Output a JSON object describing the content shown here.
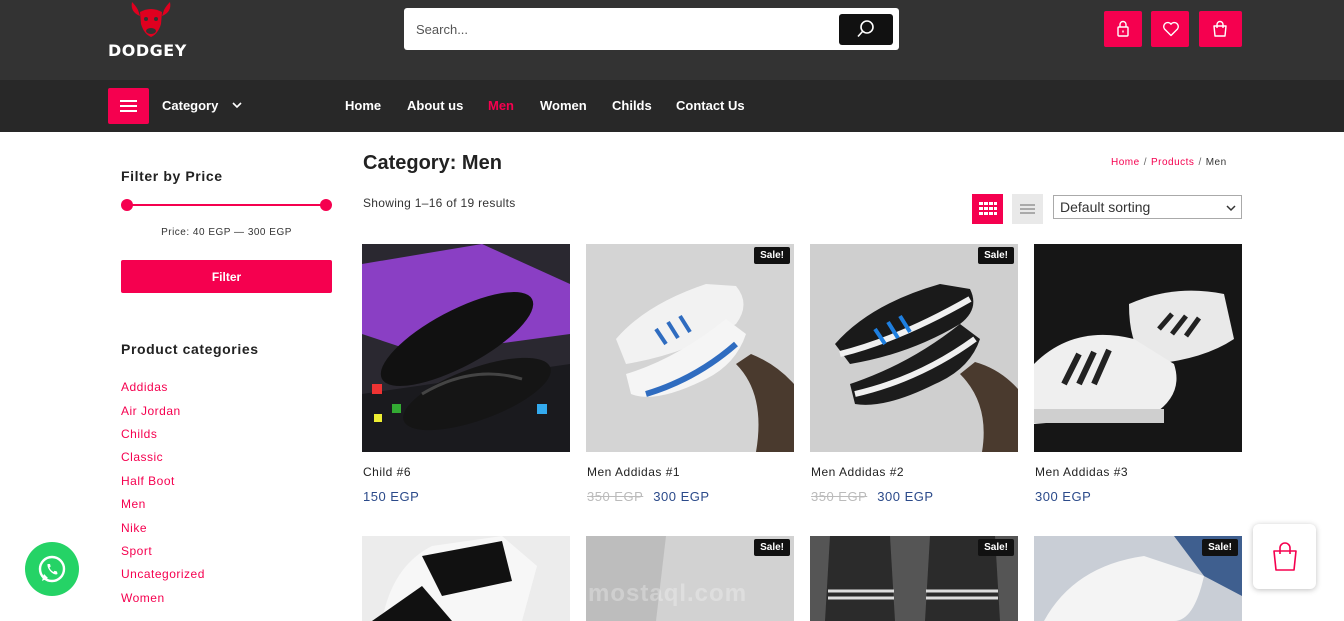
{
  "brand": {
    "name": "DODGEY",
    "accent": "#f5004f",
    "header_bg": "#333333",
    "nav_bg": "#282828"
  },
  "search": {
    "placeholder": "Search..."
  },
  "header_icons": [
    "lock-icon",
    "heart-icon",
    "bag-icon"
  ],
  "nav": {
    "category_label": "Category",
    "items": [
      "Home",
      "About us",
      "Men",
      "Women",
      "Childs",
      "Contact Us"
    ],
    "active": "Men"
  },
  "sidebar": {
    "filter_title": "Filter by Price",
    "price_range": {
      "min": 40,
      "max": 300,
      "currency": "EGP"
    },
    "price_text": "Price: 40 EGP — 300 EGP",
    "filter_button": "Filter",
    "categories_title": "Product categories",
    "categories": [
      "Addidas",
      "Air Jordan",
      "Childs",
      "Classic",
      "Half Boot",
      "Men",
      "Nike",
      "Sport",
      "Uncategorized",
      "Women"
    ]
  },
  "main": {
    "title": "Category: Men",
    "breadcrumb": [
      "Home",
      "Products",
      "Men"
    ],
    "results_text": "Showing 1–16 of 19 results",
    "sort_value": "Default sorting"
  },
  "products": [
    {
      "name": "Child #6",
      "old_price": "",
      "price": "150 EGP",
      "sale": ""
    },
    {
      "name": "Men Addidas #1",
      "old_price": "350 EGP",
      "price": "300 EGP",
      "sale": "Sale!"
    },
    {
      "name": "Men Addidas #2",
      "old_price": "350 EGP",
      "price": "300 EGP",
      "sale": "Sale!"
    },
    {
      "name": "Men Addidas #3",
      "old_price": "",
      "price": "300 EGP",
      "sale": ""
    }
  ],
  "products_row2": [
    {
      "sale": ""
    },
    {
      "sale": "Sale!"
    },
    {
      "sale": "Sale!"
    },
    {
      "sale": "Sale!"
    }
  ],
  "watermark": {
    "text": "mostaql.com"
  }
}
